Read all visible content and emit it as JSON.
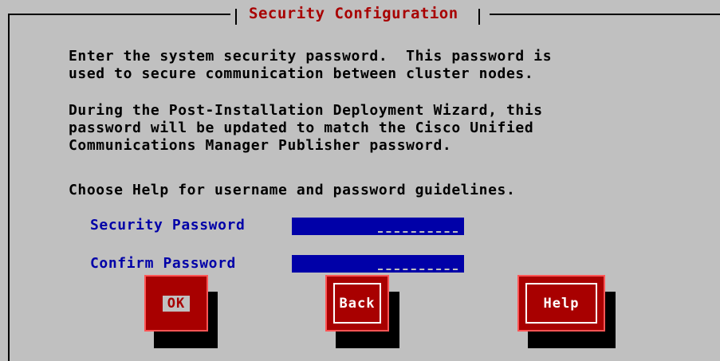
{
  "dialog": {
    "title": "Security Configuration",
    "paragraph1": "Enter the system security password.  This password is\nused to secure communication between cluster nodes.",
    "paragraph2": "During the Post-Installation Deployment Wizard, this\npassword will be updated to match the Cisco Unified\nCommunications Manager Publisher password.",
    "paragraph3": "Choose Help for username and password guidelines."
  },
  "fields": {
    "security_password": {
      "label": "Security Password",
      "value": "********"
    },
    "confirm_password": {
      "label": "Confirm Password",
      "value": "********"
    }
  },
  "buttons": {
    "ok": "OK",
    "back": "Back",
    "help": "Help"
  },
  "colors": {
    "background": "#c0c0c0",
    "title": "#a80000",
    "label": "#0000a8",
    "field": "#0000a8",
    "button": "#a80000"
  }
}
